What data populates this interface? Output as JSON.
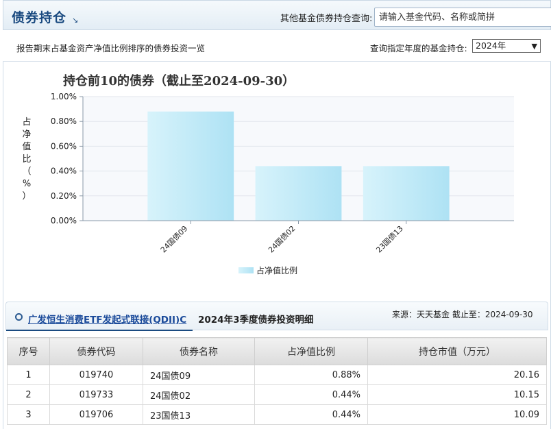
{
  "header": {
    "title": "债券持仓",
    "query_label": "其他基金债券持仓查询:",
    "search_placeholder": "请输入基金代码、名称或简拼"
  },
  "subbar": {
    "description": "报告期末占基金资产净值比例排序的债券投资一览",
    "year_label": "查询指定年度的基金持仓:",
    "year_selected": "2024年"
  },
  "chart_data": {
    "type": "bar",
    "title": "持仓前10的债券（截止至2024-09-30）",
    "ylabel": "占净值比（%）",
    "xlabel": "",
    "categories": [
      "24国债09",
      "24国债02",
      "23国债13"
    ],
    "series": [
      {
        "name": "占净值比例",
        "values": [
          0.88,
          0.44,
          0.44
        ]
      }
    ],
    "ylim": [
      0,
      1.0
    ],
    "yticks": [
      "0.00%",
      "0.20%",
      "0.40%",
      "0.60%",
      "0.80%",
      "1.00%"
    ],
    "grid": true,
    "legend": "bottom-center",
    "bar_color": "#bfe9f7"
  },
  "fund": {
    "name": "广发恒生消费ETF发起式联接(QDII)C",
    "suffix": "2024年3季度债券投资明细",
    "source": "来源：天天基金    截止至：2024-09-30"
  },
  "table": {
    "headers": [
      "序号",
      "债券代码",
      "债券名称",
      "占净值比例",
      "持仓市值（万元）"
    ],
    "rows": [
      [
        "1",
        "019740",
        "24国债09",
        "0.88%",
        "20.16"
      ],
      [
        "2",
        "019733",
        "24国债02",
        "0.44%",
        "10.15"
      ],
      [
        "3",
        "019706",
        "23国债13",
        "0.44%",
        "10.09"
      ]
    ]
  }
}
